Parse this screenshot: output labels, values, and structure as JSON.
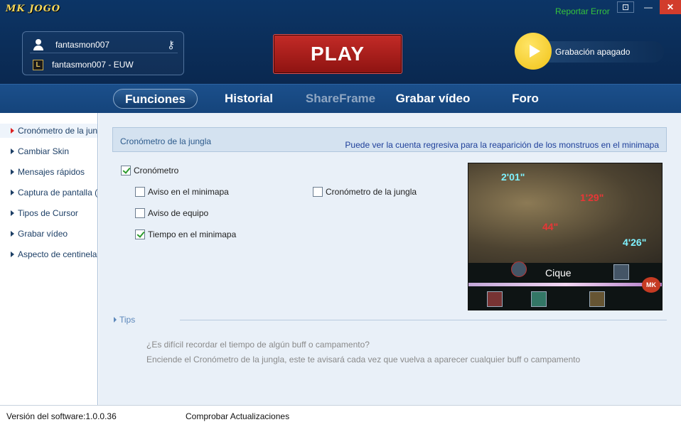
{
  "app": {
    "logo": "MK JOGO",
    "report_error": "Reportar Error"
  },
  "window_controls": {
    "dropdown": "⊡",
    "minimize": "—",
    "close": "✕"
  },
  "account": {
    "username": "fantasmon007",
    "server_account": "fantasmon007 - EUW",
    "lol_badge": "L"
  },
  "play_label": "PLAY",
  "recording": {
    "label": "Grabación apagado"
  },
  "nav": {
    "items": [
      {
        "label": "Funciones"
      },
      {
        "label": "Historial"
      },
      {
        "label": "ShareFrame"
      },
      {
        "label": "Grabar vídeo"
      },
      {
        "label": "Foro"
      }
    ]
  },
  "sidebar": {
    "items": [
      {
        "label": "Cronómetro de la jungla"
      },
      {
        "label": "Cambiar Skin"
      },
      {
        "label": "Mensajes rápidos"
      },
      {
        "label": "Captura de pantalla ("
      },
      {
        "label": "Tipos de Cursor"
      },
      {
        "label": "Grabar vídeo"
      },
      {
        "label": "Aspecto de centinela"
      }
    ]
  },
  "section": {
    "title": "Cronómetro de la jungla",
    "description": "Puede ver la cuenta regresiva para la reaparición de los monstruos en el minimapa"
  },
  "options": {
    "cronometro": {
      "label": "Cronómetro",
      "checked": true
    },
    "aviso_minimapa": {
      "label": "Aviso en el minimapa",
      "checked": false
    },
    "aviso_equipo": {
      "label": "Aviso de equipo",
      "checked": false
    },
    "tiempo_minimapa": {
      "label": "Tiempo en el minimapa",
      "checked": true
    },
    "cronometro_jungla": {
      "label": "Cronómetro de la jungla",
      "checked": false
    }
  },
  "preview": {
    "timers": [
      "2'01\"",
      "1'29\"",
      "44\"",
      "4'26\""
    ],
    "tooltip": "Cique",
    "badge": "MK"
  },
  "tips": {
    "label": "Tips",
    "line1": "¿Es difícil recordar el tiempo de algún buff o campamento?",
    "line2": "Enciende el Cronómetro de la jungla, este te avisará cada vez que vuelva a aparecer cualquier buff o campamento"
  },
  "footer": {
    "version": "Versión del software:1.0.0.36",
    "check_updates": "Comprobar Actualizaciones"
  }
}
